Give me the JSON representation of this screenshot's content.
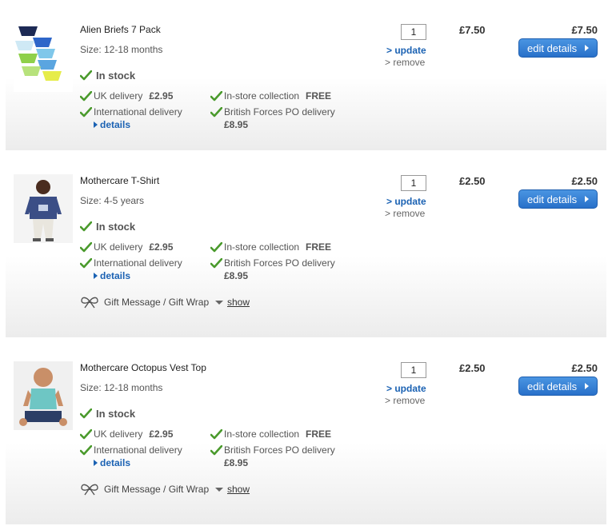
{
  "items": [
    {
      "name": "Alien Briefs 7 Pack",
      "size": "Size: 12-18 months",
      "stock": "In stock",
      "uk_label": "UK delivery",
      "uk_price": "£2.95",
      "instore_label": "In-store collection",
      "instore_price": "FREE",
      "intl_label": "International delivery",
      "details_label": "details",
      "bfpo_label": "British Forces PO delivery",
      "bfpo_price": "£8.95",
      "qty": "1",
      "update_label": "> update",
      "remove_label": "> remove",
      "price": "£7.50",
      "total": "£7.50",
      "edit_label": "edit details"
    },
    {
      "name": "Mothercare T-Shirt",
      "size": "Size: 4-5 years",
      "stock": "In stock",
      "uk_label": "UK delivery",
      "uk_price": "£2.95",
      "instore_label": "In-store collection",
      "instore_price": "FREE",
      "intl_label": "International delivery",
      "details_label": "details",
      "bfpo_label": "British Forces PO delivery",
      "bfpo_price": "£8.95",
      "qty": "1",
      "update_label": "> update",
      "remove_label": "> remove",
      "price": "£2.50",
      "total": "£2.50",
      "edit_label": "edit details",
      "gift_label": "Gift Message / Gift Wrap",
      "show_label": "show"
    },
    {
      "name": "Mothercare Octopus Vest Top",
      "size": "Size: 12-18 months",
      "stock": "In stock",
      "uk_label": "UK delivery",
      "uk_price": "£2.95",
      "instore_label": "In-store collection",
      "instore_price": "FREE",
      "intl_label": "International delivery",
      "details_label": "details",
      "bfpo_label": "British Forces PO delivery",
      "bfpo_price": "£8.95",
      "qty": "1",
      "update_label": "> update",
      "remove_label": "> remove",
      "price": "£2.50",
      "total": "£2.50",
      "edit_label": "edit details",
      "gift_label": "Gift Message / Gift Wrap",
      "show_label": "show"
    }
  ],
  "colors": {
    "link_blue": "#1b62b3",
    "button_blue": "#2870c9",
    "tick_green": "#4a9a2c"
  },
  "icons": {
    "tick": "check-icon",
    "details_arrow": "triangle-right-icon",
    "gift": "bow-icon",
    "show_arrow": "triangle-down-icon"
  }
}
